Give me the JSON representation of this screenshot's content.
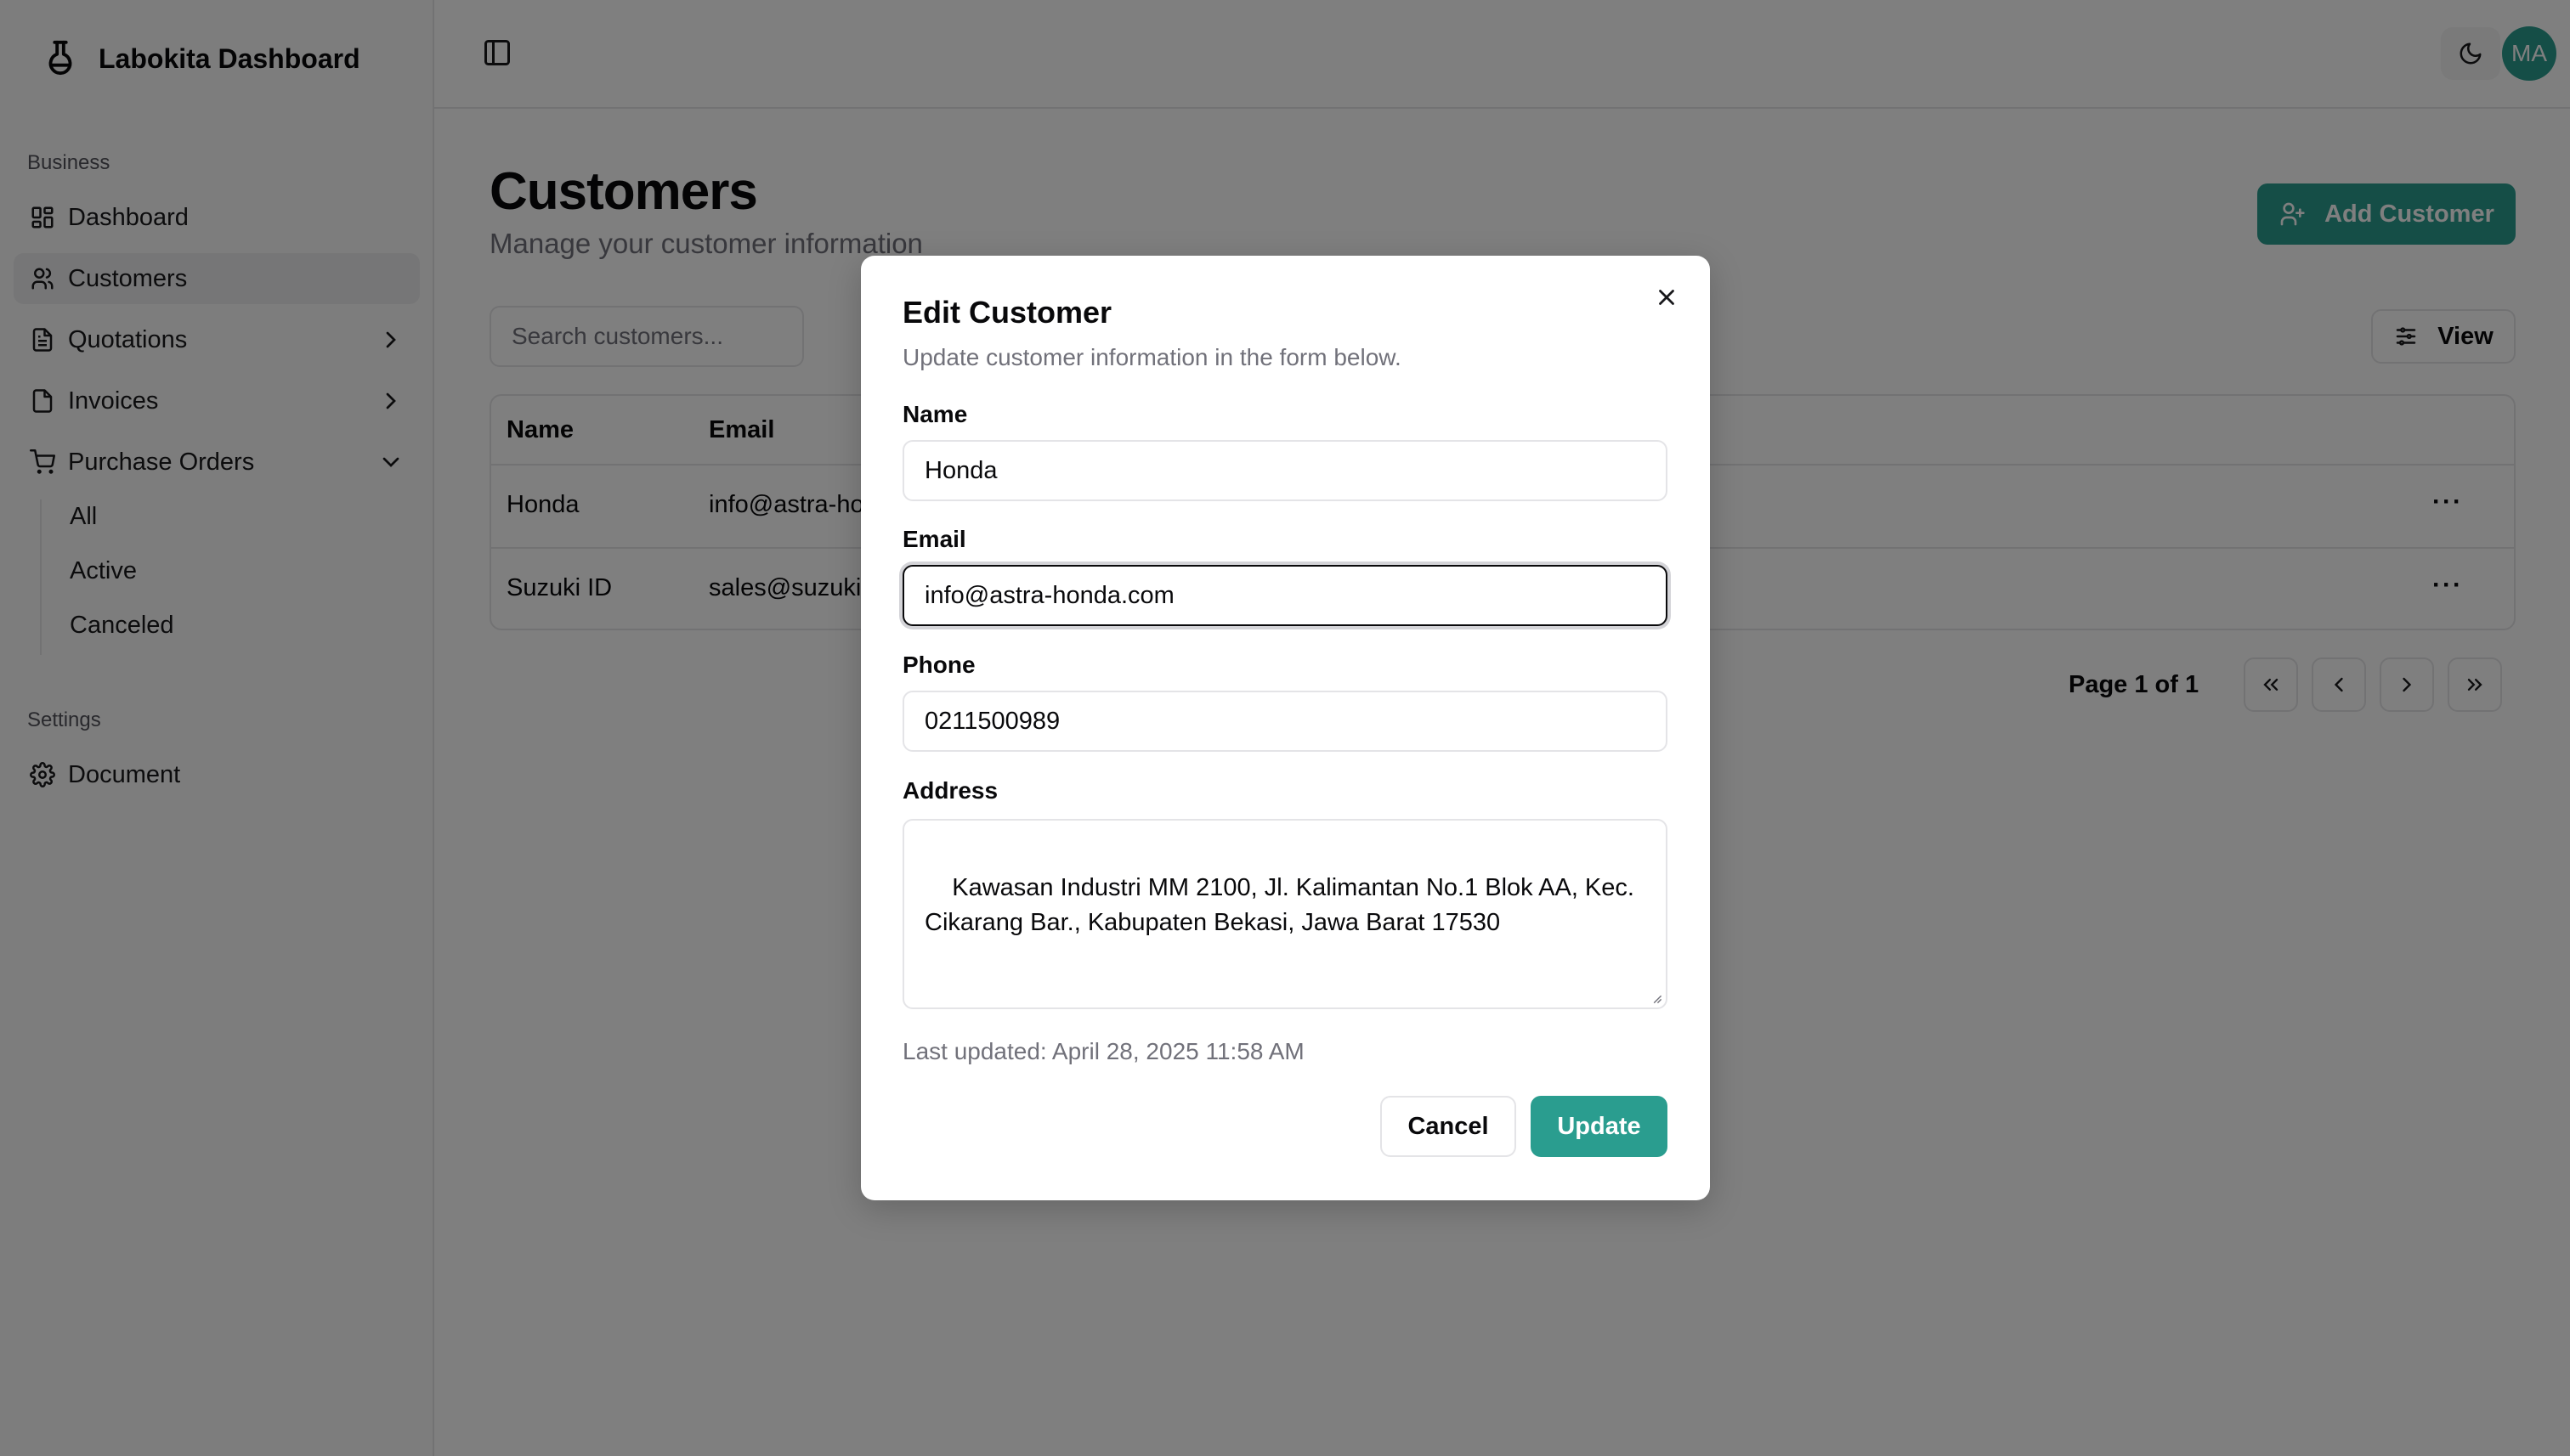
{
  "app": {
    "title": "Labokita Dashboard"
  },
  "sidebar": {
    "groups": [
      {
        "label": "Business"
      },
      {
        "label": "Settings"
      }
    ],
    "items": [
      {
        "label": "Dashboard",
        "icon": "dashboard-grid-icon"
      },
      {
        "label": "Customers",
        "icon": "users-icon",
        "active": true
      },
      {
        "label": "Quotations",
        "icon": "document-icon"
      },
      {
        "label": "Invoices",
        "icon": "file-icon"
      },
      {
        "label": "Purchase Orders",
        "icon": "cart-icon",
        "expanded": true
      },
      {
        "label": "Document",
        "icon": "gear-icon"
      }
    ],
    "sub_items": [
      {
        "label": "All"
      },
      {
        "label": "Active"
      },
      {
        "label": "Canceled"
      }
    ]
  },
  "header": {
    "avatar_initials": "MA"
  },
  "main": {
    "title": "Customers",
    "subtitle": "Manage your customer information",
    "add_button": "Add Customer",
    "search_placeholder": "Search customers...",
    "view_button": "View",
    "table": {
      "columns": [
        "Name",
        "Email"
      ],
      "rows": [
        {
          "name": "Honda",
          "email": "info@astra-ho"
        },
        {
          "name": "Suzuki ID",
          "email": "sales@suzuki"
        }
      ]
    },
    "pagination": {
      "label": "Page 1 of 1"
    }
  },
  "modal": {
    "title": "Edit Customer",
    "description": "Update customer information in the form below.",
    "fields": {
      "name": {
        "label": "Name",
        "value": "Honda"
      },
      "email": {
        "label": "Email",
        "value": "info@astra-honda.com"
      },
      "phone": {
        "label": "Phone",
        "value": "0211500989"
      },
      "address": {
        "label": "Address",
        "value": "Kawasan Industri MM 2100, Jl. Kalimantan No.1 Blok AA, Kec.\nCikarang Bar., Kabupaten Bekasi, Jawa Barat 17530"
      }
    },
    "last_updated": "Last updated: April 28, 2025 11:58 AM",
    "cancel_label": "Cancel",
    "update_label": "Update"
  },
  "colors": {
    "accent": "#2a9d8f",
    "overlay": "rgba(0,0,0,0.5)"
  }
}
